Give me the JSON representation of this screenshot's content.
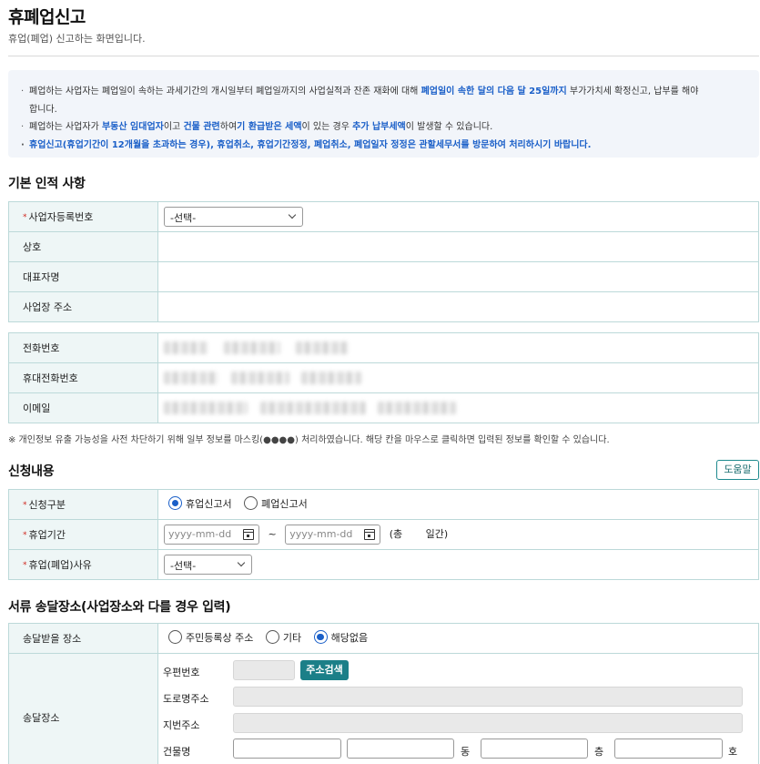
{
  "header": {
    "title": "휴폐업신고",
    "subtitle": "휴업(폐업) 신고하는 화면입니다."
  },
  "notice": {
    "line1_a": "폐업하는 사업자는 폐업일이 속하는 과세기간의 개시일부터 폐업일까지의 사업실적과 잔존 재화에 대해 ",
    "line1_hl": "폐업일이 속한 달의 다음 달 25일까지",
    "line1_b": " 부가가치세 확정신고, 납부를 해야",
    "line1_c": "합니다.",
    "line2_a": "폐업하는 사업자가 ",
    "line2_hl1": "부동산 임대업자",
    "line2_b": "이고 ",
    "line2_hl2": "건물 관련",
    "line2_c": "하여",
    "line2_hl3": "기 환급받은 세액",
    "line2_d": "이 있는 경우 ",
    "line2_hl4": "추가 납부세액",
    "line2_e": "이 발생할 수 있습니다.",
    "line3": "휴업신고(휴업기간이 12개월을 초과하는 경우), 휴업취소, 휴업기간정정, 폐업취소, 폐업일자 정정은 관할세무서를 방문하여 처리하시기 바랍니다."
  },
  "basic": {
    "section_title": "기본 인적 사항",
    "biz_no_label": "사업자등록번호",
    "biz_no_value": "-선택-",
    "trade_name_label": "상호",
    "ceo_label": "대표자명",
    "address_label": "사업장 주소",
    "phone_label": "전화번호",
    "mobile_label": "휴대전화번호",
    "email_label": "이메일",
    "mask_note": "※ 개인정보 유출 가능성을 사전 차단하기 위해 일부 정보를 마스킹(●●●●) 처리하였습니다. 해당 칸을 마우스로 클릭하면 입력된 정보를 확인할 수 있습니다."
  },
  "apply": {
    "section_title": "신청내용",
    "help_label": "도움말",
    "type_label": "신청구분",
    "type_options": [
      "휴업신고서",
      "폐업신고서"
    ],
    "type_selected": "휴업신고서",
    "period_label": "휴업기간",
    "date_placeholder": "yyyy-mm-dd",
    "tilde": "~",
    "days_open": "(총",
    "days_close": "일간)",
    "reason_label": "휴업(폐업)사유",
    "reason_value": "-선택-"
  },
  "delivery": {
    "section_title": "서류 송달장소(사업장소와 다를 경우 입력)",
    "place_label": "송달받을 장소",
    "place_options": [
      "주민등록상 주소",
      "기타",
      "해당없음"
    ],
    "place_selected": "해당없음",
    "addr_label": "송달장소",
    "zip_label": "우편번호",
    "search_btn": "주소검색",
    "road_label": "도로명주소",
    "jibun_label": "지번주소",
    "building_label": "건물명",
    "dong": "동",
    "floor": "층",
    "ho": "호"
  },
  "colors": {
    "accent_blue": "#1a5fc8",
    "teal": "#1b7f88",
    "label_bg": "#eef6f6",
    "required_red": "#d0281f"
  }
}
